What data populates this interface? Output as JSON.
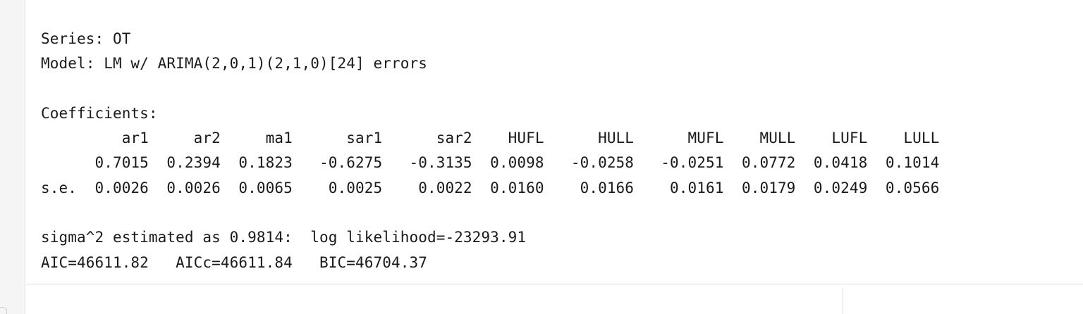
{
  "output": {
    "series_line": "Series: OT",
    "model_line": "Model: LM w/ ARIMA(2,0,1)(2,1,0)[24] errors",
    "coefficients_heading": "Coefficients:",
    "header_row": "         ar1     ar2     ma1      sar1      sar2    HUFL      HULL      MUFL    MULL    LUFL    LULL",
    "estimate_row": "      0.7015  0.2394  0.1823   -0.6275   -0.3135  0.0098   -0.0258   -0.0251  0.0772  0.0418  0.1014",
    "se_row": "s.e.  0.0026  0.0026  0.0065    0.0025    0.0022  0.0160    0.0166    0.0161  0.0179  0.0249  0.0566",
    "sigma_line": "sigma^2 estimated as 0.9814:  log likelihood=-23293.91",
    "ic_line": "AIC=46611.82   AICc=46611.84   BIC=46704.37"
  }
}
